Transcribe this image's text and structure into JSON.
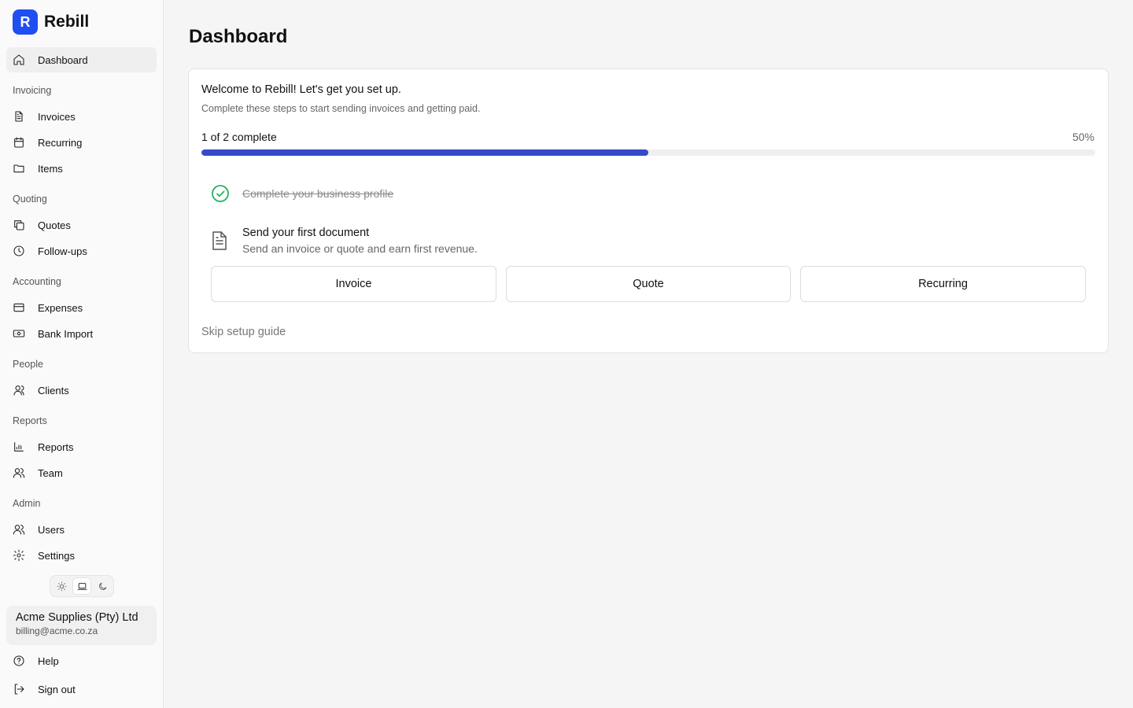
{
  "brand": {
    "logo_letter": "R",
    "name": "Rebill",
    "color": "#1f4ff0"
  },
  "sidebar": {
    "dashboard": {
      "label": "Dashboard",
      "icon": "home-icon"
    },
    "groups": {
      "invoicing": "Invoicing",
      "quoting": "Quoting",
      "accounting": "Accounting",
      "people": "People",
      "reports": "Reports",
      "admin": "Admin"
    },
    "items": {
      "invoices": {
        "label": "Invoices",
        "icon": "file-text-icon"
      },
      "recurring": {
        "label": "Recurring",
        "icon": "calendar-icon"
      },
      "items": {
        "label": "Items",
        "icon": "folder-icon"
      },
      "quotes": {
        "label": "Quotes",
        "icon": "copy-icon"
      },
      "followups": {
        "label": "Follow-ups",
        "icon": "clock-icon"
      },
      "expenses": {
        "label": "Expenses",
        "icon": "credit-card-icon"
      },
      "bank_import": {
        "label": "Bank Import",
        "icon": "banknote-icon"
      },
      "clients": {
        "label": "Clients",
        "icon": "user-icon"
      },
      "reports": {
        "label": "Reports",
        "icon": "bar-chart-icon"
      },
      "team": {
        "label": "Team",
        "icon": "users-icon"
      },
      "users": {
        "label": "Users",
        "icon": "users-icon"
      },
      "settings": {
        "label": "Settings",
        "icon": "gear-icon"
      },
      "help": {
        "label": "Help",
        "icon": "help-circle-icon"
      },
      "signout": {
        "label": "Sign out",
        "icon": "log-out-icon"
      }
    },
    "theme": {
      "options": [
        "light",
        "system",
        "dark"
      ],
      "selected": "system"
    },
    "account": {
      "name": "Acme Supplies (Pty) Ltd",
      "email": "billing@acme.co.za"
    }
  },
  "main": {
    "title": "Dashboard",
    "setup": {
      "title": "Welcome to Rebill! Let's get you set up.",
      "subtitle": "Complete these steps to start sending invoices and getting paid.",
      "progress_label": "1 of 2 complete",
      "progress_percent_text": "50%",
      "progress_fraction": 0.5,
      "progress_color": "#3649c8",
      "steps": [
        {
          "title": "Complete your business profile",
          "done": true,
          "icon": "check-circle-icon",
          "color": "#22b35e"
        },
        {
          "title": "Send your first document",
          "subtitle": "Send an invoice or quote and earn first revenue.",
          "done": false,
          "icon": "file-text-icon"
        }
      ],
      "actions": [
        "Invoice",
        "Quote",
        "Recurring"
      ],
      "skip_label": "Skip setup guide"
    }
  }
}
